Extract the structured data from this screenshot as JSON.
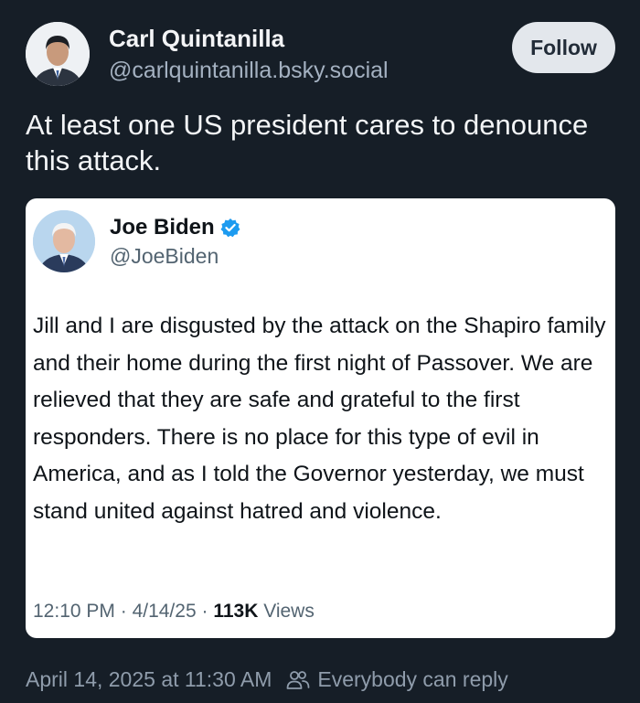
{
  "post": {
    "author": {
      "name": "Carl Quintanilla",
      "handle": "@carlquintanilla.bsky.social"
    },
    "follow_label": "Follow",
    "text": "At least one US president cares to denounce this attack.",
    "timestamp": "April 14, 2025 at 11:30 AM",
    "reply_setting": "Everybody can reply"
  },
  "quoted": {
    "author": {
      "name": "Joe Biden",
      "handle": "@JoeBiden",
      "verified": true
    },
    "text": "Jill and I are disgusted by the attack on the Shapiro family and their home during the first night of Passover. We are relieved that they are safe and grateful to the first responders. There is no place for this type of evil in America, and as I told the Governor yesterday, we must stand united against hatred and violence.",
    "time": "12:10 PM",
    "date": "4/14/25",
    "views_count": "113K",
    "views_label": "Views"
  },
  "colors": {
    "background": "#161e27",
    "verified_badge": "#1d9bf0",
    "follow_button_bg": "#e3e7ec"
  },
  "icons": {
    "verified": "verified-badge-icon",
    "reply_setting": "people-icon"
  }
}
